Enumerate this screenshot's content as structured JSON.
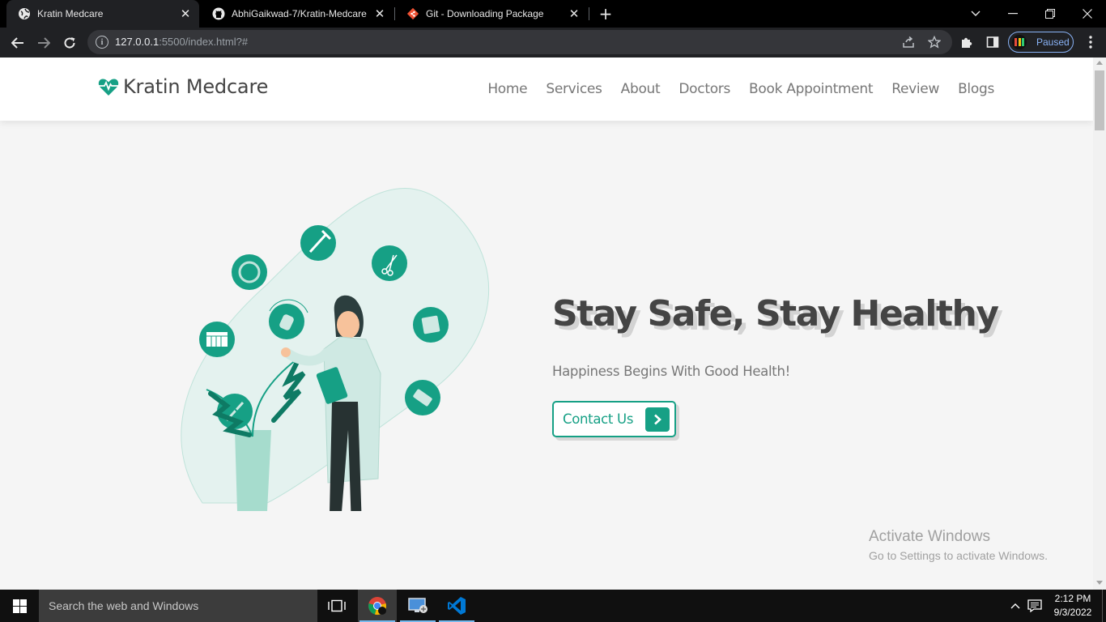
{
  "browser": {
    "tabs": [
      {
        "title": "Kratin Medcare",
        "favicon": "globe-icon",
        "active": true
      },
      {
        "title": "AbhiGaikwad-7/Kratin-Medcare",
        "favicon": "github-icon",
        "active": false
      },
      {
        "title": "Git - Downloading Package",
        "favicon": "git-icon",
        "active": false
      }
    ],
    "url_host": "127.0.0.1",
    "url_path": ":5500/index.html?#",
    "profile_status": "Paused"
  },
  "site": {
    "brand": "Kratin Medcare",
    "accent_color": "#16a085",
    "nav": [
      "Home",
      "Services",
      "About",
      "Doctors",
      "Book Appointment",
      "Review",
      "Blogs"
    ],
    "hero": {
      "title": "Stay Safe, Stay Healthy",
      "subtitle": "Happiness Begins With Good Health!",
      "cta": "Contact Us"
    }
  },
  "watermark": {
    "line1": "Activate Windows",
    "line2": "Go to Settings to activate Windows."
  },
  "taskbar": {
    "search_placeholder": "Search the web and Windows",
    "time": "2:12 PM",
    "date": "9/3/2022"
  }
}
